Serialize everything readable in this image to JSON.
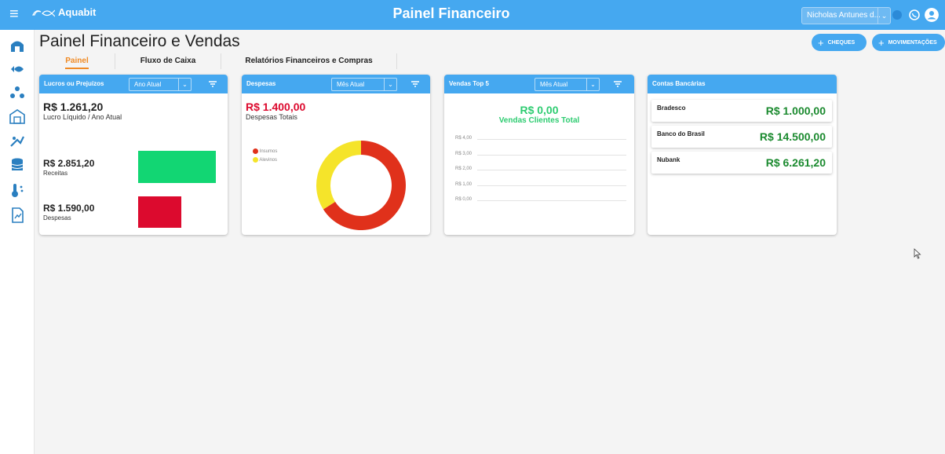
{
  "topbar": {
    "logo_text": "Aquabit",
    "title": "Painel Financeiro",
    "user_name": "Nicholas Antunes d...",
    "menu_icon": "hamburger-icon",
    "icons": [
      "status-dot-icon",
      "whatsapp-icon",
      "user-profile-icon"
    ]
  },
  "sidebar": {
    "icons": [
      "farm-icon",
      "fish-icon",
      "clusters-icon",
      "warehouse-icon",
      "feeding-icon",
      "database-icon",
      "thermometer-icon",
      "report-icon"
    ]
  },
  "page": {
    "title": "Painel Financeiro e Vendas",
    "btn_cheques": "CHEQUES",
    "btn_movimentacoes": "MOVIMENTAÇÕES"
  },
  "tabs": [
    "Painel",
    "Fluxo de Caixa",
    "Relatórios Financeiros e Compras"
  ],
  "lucros": {
    "header": "Lucros ou Prejuízos",
    "period": "Ano Atual",
    "net_value": "R$ 1.261,20",
    "net_label": "Lucro Líquido / Ano Atual",
    "revenue_value": "R$ 2.851,20",
    "revenue_label": "Receitas",
    "expense_value": "R$ 1.590,00",
    "expense_label": "Despesas",
    "revenue_color": "#12d673",
    "expense_color": "#dc0a2e"
  },
  "despesas": {
    "header": "Despesas",
    "period": "Mês Atual",
    "total_value": "R$ 1.400,00",
    "total_label": "Despesas Totais",
    "legend": [
      {
        "label": "Insumos",
        "color": "#e0311b"
      },
      {
        "label": "Alevinos",
        "color": "#f5e42a"
      }
    ]
  },
  "vendas": {
    "header": "Vendas Top 5",
    "period": "Mês Atual",
    "total_value": "R$ 0,00",
    "total_label": "Vendas Clientes Total",
    "accent": "#2ecc71"
  },
  "contas": {
    "header": "Contas Bancárias",
    "banks": [
      {
        "name": "Bradesco",
        "value": "R$ 1.000,00"
      },
      {
        "name": "Banco do Brasil",
        "value": "R$ 14.500,00"
      },
      {
        "name": "Nubank",
        "value": "R$ 6.261,20"
      }
    ]
  },
  "chart_data": [
    {
      "type": "pie",
      "categories": [
        "Insumos",
        "Alevinos"
      ],
      "values": [
        66,
        34
      ],
      "title": ""
    },
    {
      "type": "line",
      "title": "",
      "y_ticks": [
        "R$ 4,00",
        "R$ 3,00",
        "R$ 2,00",
        "R$ 1,00",
        "R$ 0,00"
      ],
      "ylim": [
        0,
        4
      ],
      "series": []
    }
  ]
}
